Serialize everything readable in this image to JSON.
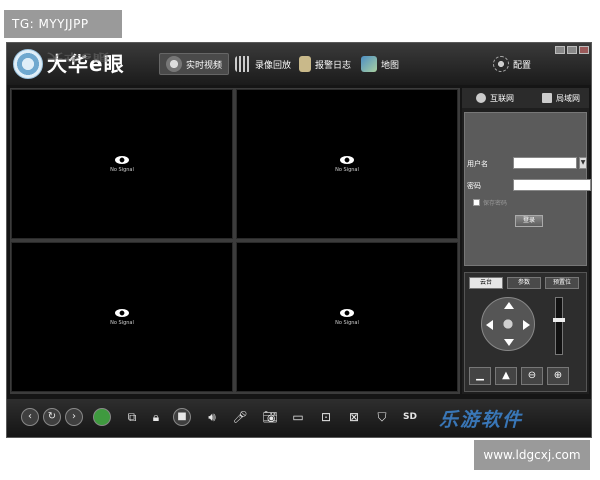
{
  "overlay": {
    "tg_label": "TG: MYYJJPP",
    "url_label": "www.ldgcxj.com"
  },
  "app": {
    "logo_text": "大华e眼",
    "nav": [
      {
        "label": "实时视频",
        "icon": "camera-icon"
      },
      {
        "label": "录像回放",
        "icon": "film-icon"
      },
      {
        "label": "报警日志",
        "icon": "clipboard-icon"
      },
      {
        "label": "地图",
        "icon": "map-icon"
      },
      {
        "label": "配置",
        "icon": "gear-icon"
      }
    ]
  },
  "video": {
    "cells": [
      {
        "status": "No Signal"
      },
      {
        "status": "No Signal"
      },
      {
        "status": "No Signal"
      },
      {
        "status": "No Signal"
      }
    ]
  },
  "panel": {
    "tabs": [
      "互联网",
      "局域网"
    ],
    "login": {
      "username_label": "用户名",
      "password_label": "密码",
      "remember_label": "保存密码",
      "login_button": "登录"
    },
    "ptz": {
      "tabs": [
        "云台",
        "参数",
        "预置位"
      ]
    }
  },
  "toolbar": {
    "sd_label": "SD",
    "watermark": "乐游软件"
  }
}
